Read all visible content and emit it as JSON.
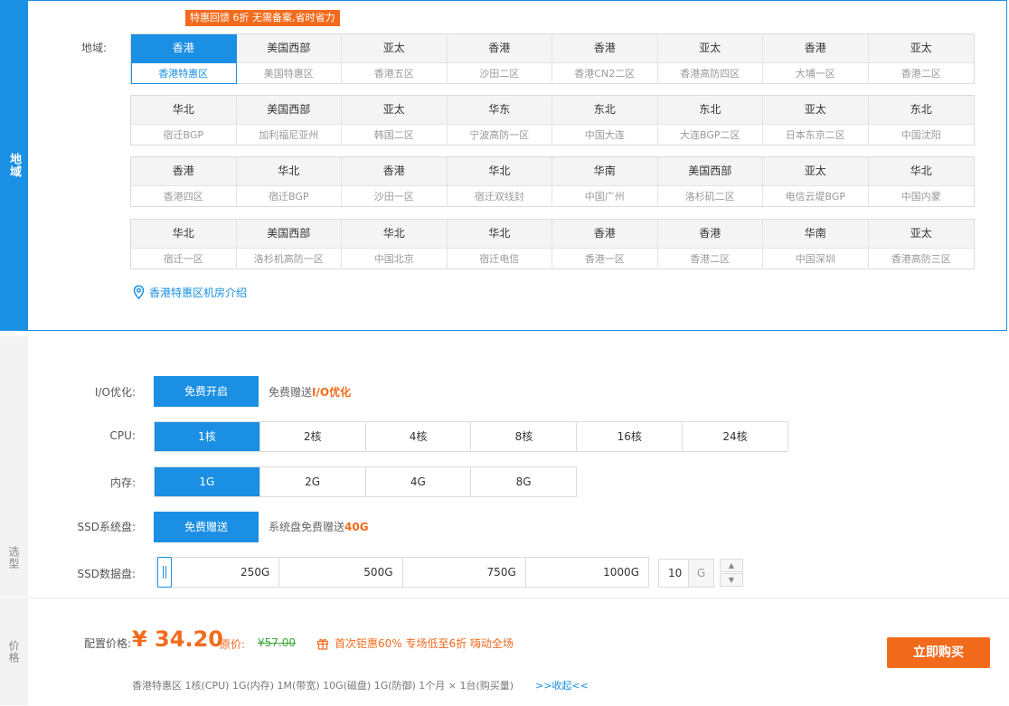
{
  "sidebar": {
    "region": "地域",
    "select": "选型",
    "price": "价格"
  },
  "promo": "特惠回馈 6折 无需备案,省时省力",
  "region_label": "地域:",
  "region_groups": [
    [
      {
        "area": "香港",
        "name": "香港特惠区",
        "selected": true
      },
      {
        "area": "美国西部",
        "name": "美国特惠区"
      },
      {
        "area": "亚太",
        "name": "香港五区"
      },
      {
        "area": "香港",
        "name": "沙田二区"
      },
      {
        "area": "香港",
        "name": "香港CN2二区"
      },
      {
        "area": "亚太",
        "name": "香港高防四区"
      },
      {
        "area": "香港",
        "name": "大埔一区"
      },
      {
        "area": "亚太",
        "name": "香港二区"
      }
    ],
    [
      {
        "area": "华北",
        "name": "宿迁BGP"
      },
      {
        "area": "美国西部",
        "name": "加利福尼亚州"
      },
      {
        "area": "亚太",
        "name": "韩国二区"
      },
      {
        "area": "华东",
        "name": "宁波高防一区"
      },
      {
        "area": "东北",
        "name": "中国大连"
      },
      {
        "area": "东北",
        "name": "大连BGP二区"
      },
      {
        "area": "亚太",
        "name": "日本东京二区"
      },
      {
        "area": "东北",
        "name": "中国沈阳"
      }
    ],
    [
      {
        "area": "香港",
        "name": "香港四区"
      },
      {
        "area": "华北",
        "name": "宿迁BGP"
      },
      {
        "area": "香港",
        "name": "沙田一区"
      },
      {
        "area": "华北",
        "name": "宿迁双线封"
      },
      {
        "area": "华南",
        "name": "中国广州"
      },
      {
        "area": "美国西部",
        "name": "洛杉矶二区"
      },
      {
        "area": "亚太",
        "name": "电信云堤BGP"
      },
      {
        "area": "华北",
        "name": "中国内蒙"
      }
    ],
    [
      {
        "area": "华北",
        "name": "宿迁一区"
      },
      {
        "area": "美国西部",
        "name": "洛杉机高防一区"
      },
      {
        "area": "华北",
        "name": "中国北京"
      },
      {
        "area": "华北",
        "name": "宿迁电信"
      },
      {
        "area": "香港",
        "name": "香港一区"
      },
      {
        "area": "香港",
        "name": "香港二区"
      },
      {
        "area": "华南",
        "name": "中国深圳"
      },
      {
        "area": "亚太",
        "name": "香港高防三区"
      }
    ]
  ],
  "dc_link": "香港特惠区机房介绍",
  "io": {
    "label": "I/O优化:",
    "button": "免费开启",
    "note_prefix": "免费赠送",
    "note_highlight": "I/O优化"
  },
  "cpu": {
    "label": "CPU:",
    "options": [
      "1核",
      "2核",
      "4核",
      "8核",
      "16核",
      "24核"
    ],
    "selected": 0
  },
  "memory": {
    "label": "内存:",
    "options": [
      "1G",
      "2G",
      "4G",
      "8G"
    ],
    "selected": 0
  },
  "system_disk": {
    "label": "SSD系统盘:",
    "button": "免费赠送",
    "note_prefix": "系统盘免费赠送",
    "note_highlight": "40G"
  },
  "data_disk": {
    "label": "SSD数据盘:",
    "marks": [
      "250G",
      "500G",
      "750G",
      "1000G"
    ],
    "value": "10",
    "unit": "G"
  },
  "price": {
    "label": "配置价格:",
    "value": "¥ 34.20",
    "original_label": "原价:",
    "original_value": "¥57.00",
    "promo": "首次钜惠60% 专场低至6折 嗨动全场",
    "buy": "立即购买",
    "summary": "香港特惠区 1核(CPU) 1G(内存) 1M(带宽) 10G(磁盘) 1G(防御) 1个月 × 1台(购买量)",
    "collapse": ">>收起<<"
  },
  "colors": {
    "accent": "#1a8fe3",
    "orange": "#f26b1d",
    "green": "#3aa63a"
  },
  "icons": {
    "location": "location-pin-icon",
    "gift": "gift-icon",
    "up": "caret-up-icon",
    "down": "caret-down-icon"
  }
}
